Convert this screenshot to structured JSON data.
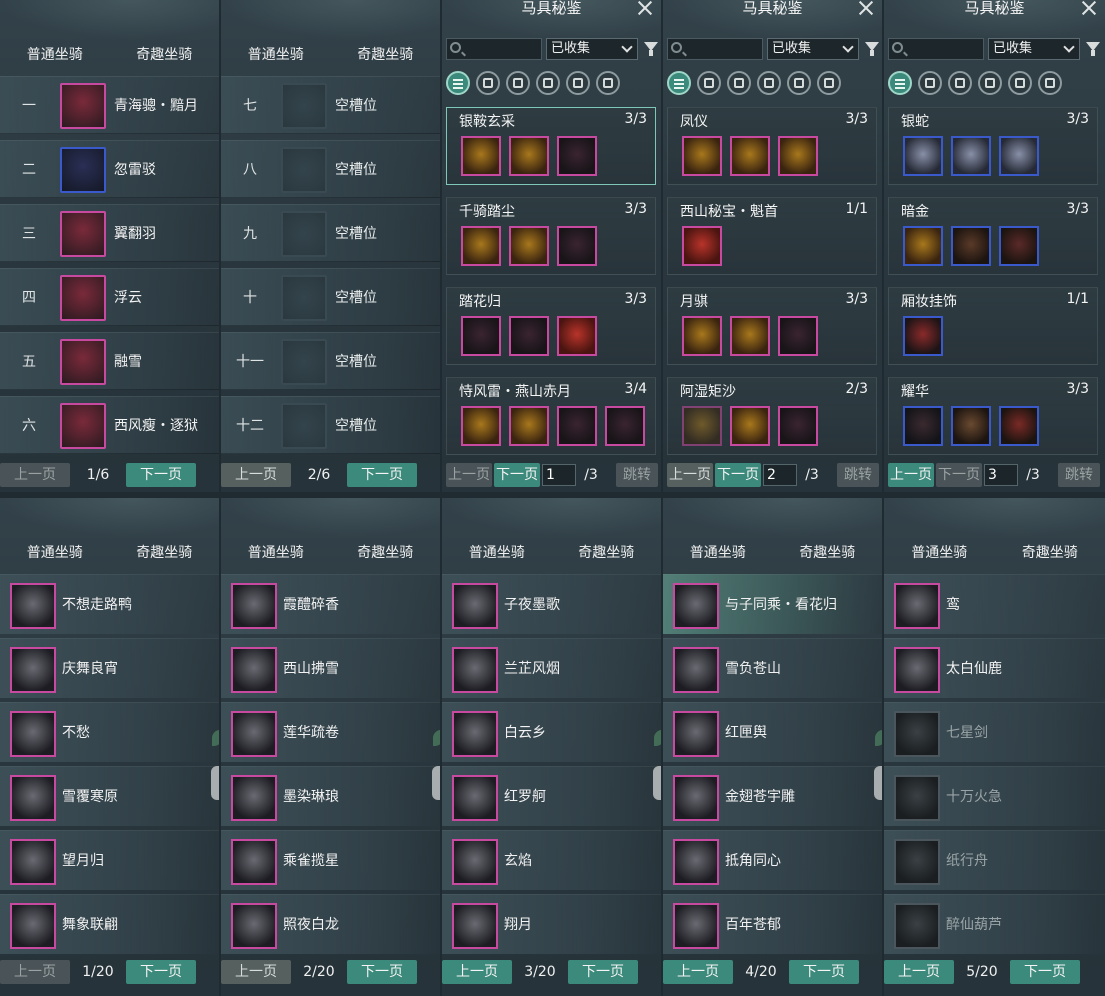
{
  "tabs": {
    "normal": "普通坐骑",
    "fun": "奇趣坐骑"
  },
  "pager": {
    "prev": "上一页",
    "next": "下一页",
    "jump": "跳转"
  },
  "top_panels": [
    {
      "page": "1/6",
      "slots": [
        {
          "num": "一",
          "name": "青海骢・黯月",
          "rarity": "purple"
        },
        {
          "num": "二",
          "name": "忽雷驳",
          "rarity": "blue"
        },
        {
          "num": "三",
          "name": "翼翻羽",
          "rarity": "purple"
        },
        {
          "num": "四",
          "name": "浮云",
          "rarity": "purple"
        },
        {
          "num": "五",
          "name": "融雪",
          "rarity": "purple"
        },
        {
          "num": "六",
          "name": "西风瘦・逐狱",
          "rarity": "purple"
        }
      ]
    },
    {
      "page": "2/6",
      "slots": [
        {
          "num": "七",
          "name": "空槽位"
        },
        {
          "num": "八",
          "name": "空槽位"
        },
        {
          "num": "九",
          "name": "空槽位"
        },
        {
          "num": "十",
          "name": "空槽位"
        },
        {
          "num": "十一",
          "name": "空槽位"
        },
        {
          "num": "十二",
          "name": "空槽位"
        }
      ]
    }
  ],
  "catalog": {
    "title": "马具秘鉴",
    "filter_value": "已收集",
    "panels": [
      {
        "page_input": "1",
        "page_total": "/3",
        "sets": [
          {
            "name": "银鞍玄采",
            "count": "3/3",
            "gear": [
              "purple",
              "purple",
              "purple"
            ]
          },
          {
            "name": "千骑踏尘",
            "count": "3/3",
            "gear": [
              "purple",
              "purple",
              "purple"
            ]
          },
          {
            "name": "踏花归",
            "count": "3/3",
            "gear": [
              "purple-dark",
              "purple-dark",
              "purple-red"
            ]
          },
          {
            "name": "恃风雷・燕山赤月",
            "count": "3/4",
            "gear": [
              "purple",
              "purple",
              "purple",
              "purple-dark"
            ]
          }
        ]
      },
      {
        "page_input": "2",
        "page_total": "/3",
        "sets": [
          {
            "name": "凤仪",
            "count": "3/3",
            "gear": [
              "purple",
              "purple",
              "purple"
            ]
          },
          {
            "name": "西山秘宝・魁首",
            "count": "1/1",
            "gear": [
              "purple-red"
            ]
          },
          {
            "name": "月骐",
            "count": "3/3",
            "gear": [
              "purple",
              "purple",
              "purple"
            ]
          },
          {
            "name": "阿湿矩沙",
            "count": "2/3",
            "gear": [
              "purple-dim",
              "purple",
              "purple"
            ]
          }
        ]
      },
      {
        "page_input": "3",
        "page_total": "/3",
        "sets": [
          {
            "name": "银蛇",
            "count": "3/3",
            "gear": [
              "blue",
              "blue",
              "blue"
            ]
          },
          {
            "name": "暗金",
            "count": "3/3",
            "gear": [
              "blue",
              "blue",
              "blue"
            ]
          },
          {
            "name": "厢妆挂饰",
            "count": "1/1",
            "gear": [
              "blue-dark"
            ]
          },
          {
            "name": "耀华",
            "count": "3/3",
            "gear": [
              "blue-dark",
              "blue-dark",
              "blue-dark"
            ]
          }
        ]
      }
    ]
  },
  "bottom_panels": [
    {
      "page": "1/20",
      "items": [
        {
          "name": "不想走路鸭"
        },
        {
          "name": "庆舞良宵"
        },
        {
          "name": "不愁"
        },
        {
          "name": "雪覆寒原"
        },
        {
          "name": "望月归"
        },
        {
          "name": "舞象联翩"
        }
      ]
    },
    {
      "page": "2/20",
      "items": [
        {
          "name": "霞醴碎香"
        },
        {
          "name": "西山拂雪"
        },
        {
          "name": "莲华疏卷"
        },
        {
          "name": "墨染琳琅"
        },
        {
          "name": "乘雀揽星"
        },
        {
          "name": "照夜白龙"
        }
      ]
    },
    {
      "page": "3/20",
      "items": [
        {
          "name": "子夜墨歌"
        },
        {
          "name": "兰芷风烟"
        },
        {
          "name": "白云乡"
        },
        {
          "name": "红罗舸"
        },
        {
          "name": "玄焰"
        },
        {
          "name": "翔月"
        }
      ]
    },
    {
      "page": "4/20",
      "items": [
        {
          "name": "与子同乘・看花归",
          "highlight": true
        },
        {
          "name": "雪负苍山"
        },
        {
          "name": "红匣舆"
        },
        {
          "name": "金翅苍宇雕"
        },
        {
          "name": "抵角同心"
        },
        {
          "name": "百年苍郁"
        }
      ]
    },
    {
      "page": "5/20",
      "items": [
        {
          "name": "鸾"
        },
        {
          "name": "太白仙鹿"
        },
        {
          "name": "七星剑",
          "locked": true
        },
        {
          "name": "十万火急",
          "locked": true
        },
        {
          "name": "纸行舟",
          "locked": true
        },
        {
          "name": "醉仙葫芦",
          "locked": true
        }
      ]
    }
  ]
}
